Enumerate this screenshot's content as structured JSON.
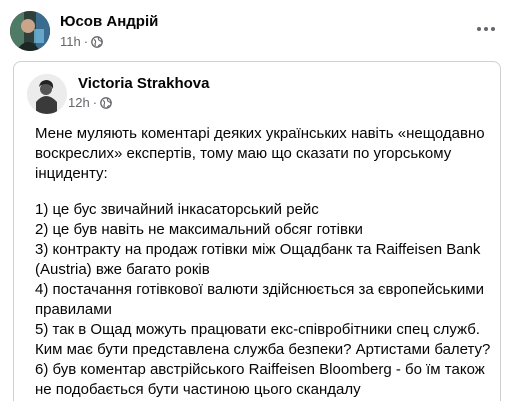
{
  "post": {
    "author": "Юсов Андрій",
    "time": "11h",
    "separator": "·",
    "privacy_icon": "globe-icon",
    "more_icon": "more-options-icon"
  },
  "shared_post": {
    "author": "Victoria Strakhova",
    "time": "12h",
    "separator": "·",
    "privacy_icon": "globe-icon",
    "intro": "Мене муляють коментарі деяких українських навіть «нещодавно воскреслих» експертів, тому маю що сказати по угорському інциденту:",
    "lines": [
      "1) це бус звичайний інкасаторський рейс",
      "2) це був навіть не максимальний обсяг готівки",
      "3) контракту на продаж готівки між Ощадбанк та Raiffeisen Bank (Austria) вже багато років",
      "4) постачання готівкової валюти здійснюється за європейськими правилами",
      "5) так в Ощад можуть працювати екс-співробітники спец служб. Ким має бути представлена служба безпеки? Артистами балету?",
      "6) був коментар австрійського Raiffeisen Bloomberg - бо їм також не подобається бути частиною цього скандалу"
    ]
  },
  "colors": {
    "text": "#050505",
    "secondary": "#65676b",
    "border": "#ced0d4"
  }
}
